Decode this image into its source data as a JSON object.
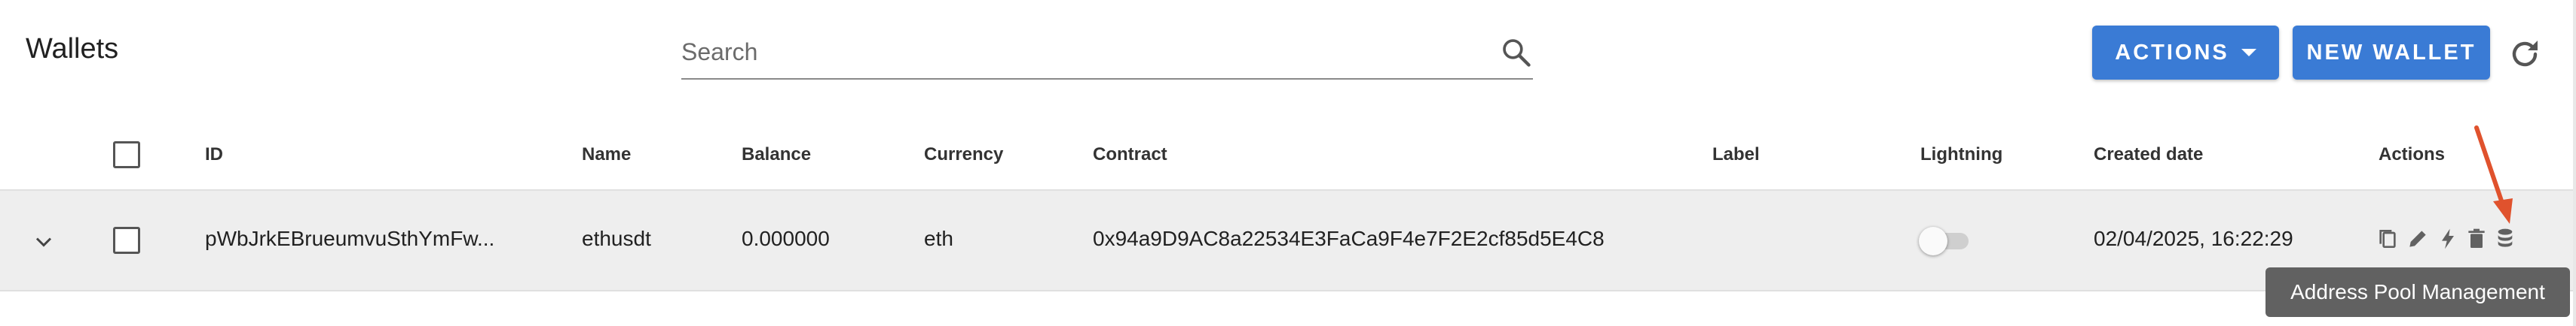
{
  "header": {
    "title": "Wallets",
    "search_placeholder": "Search",
    "actions_button": "ACTIONS",
    "new_wallet_button": "NEW WALLET"
  },
  "table": {
    "columns": [
      "ID",
      "Name",
      "Balance",
      "Currency",
      "Contract",
      "Label",
      "Lightning",
      "Created date",
      "Actions"
    ],
    "rows": [
      {
        "id": "pWbJrkEBrueumvuSthYmFw...",
        "name": "ethusdt",
        "balance": "0.000000",
        "currency": "eth",
        "contract": "0x94a9D9AC8a22534E3FaCa9F4e7F2E2cf85d5E4C8",
        "label": "",
        "lightning": false,
        "created_date": "02/04/2025, 16:22:29"
      }
    ],
    "row_actions": [
      "copy-icon",
      "edit-icon",
      "lightning-icon",
      "delete-icon",
      "database-icon"
    ]
  },
  "tooltip": "Address Pool Management",
  "colors": {
    "primary_button": "#3a7bd5",
    "row_highlight": "#eeeeee",
    "annotation_arrow": "#e0522d",
    "tooltip_bg": "#616161"
  }
}
